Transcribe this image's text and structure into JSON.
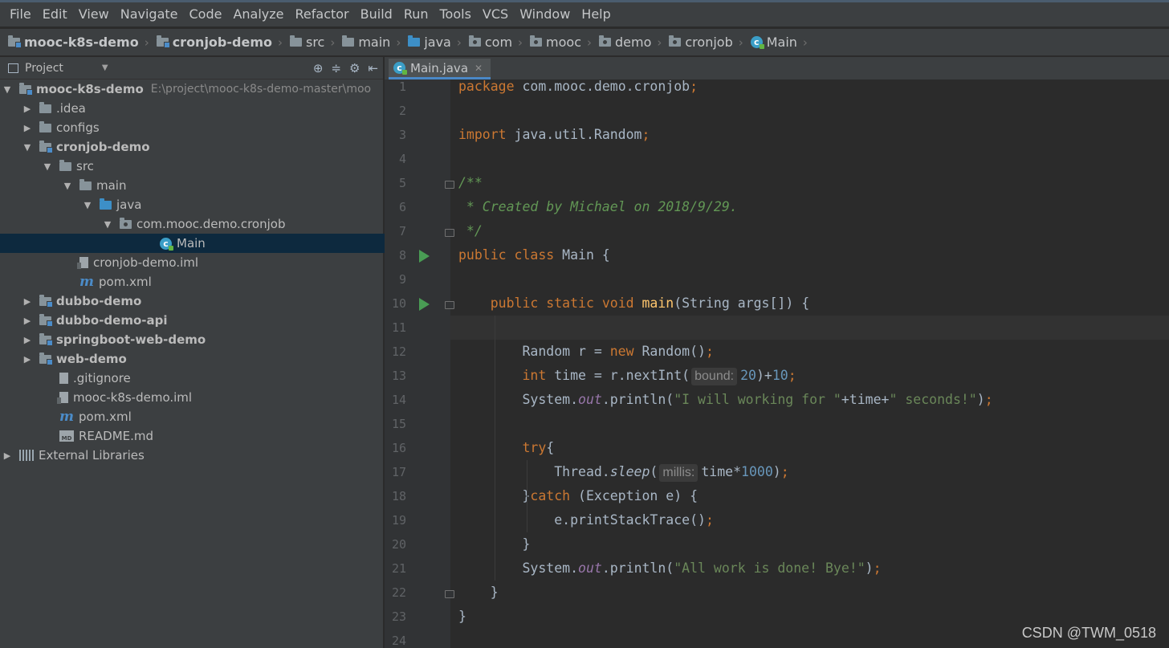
{
  "menu": [
    "File",
    "Edit",
    "View",
    "Navigate",
    "Code",
    "Analyze",
    "Refactor",
    "Build",
    "Run",
    "Tools",
    "VCS",
    "Window",
    "Help"
  ],
  "breadcrumb": [
    {
      "label": "mooc-k8s-demo",
      "icon": "module-folder-icon"
    },
    {
      "label": "cronjob-demo",
      "icon": "module-folder-icon"
    },
    {
      "label": "src",
      "icon": "folder-icon"
    },
    {
      "label": "main",
      "icon": "folder-icon"
    },
    {
      "label": "java",
      "icon": "source-folder-icon"
    },
    {
      "label": "com",
      "icon": "package-icon"
    },
    {
      "label": "mooc",
      "icon": "package-icon"
    },
    {
      "label": "demo",
      "icon": "package-icon"
    },
    {
      "label": "cronjob",
      "icon": "package-icon"
    },
    {
      "label": "Main",
      "icon": "class-icon"
    }
  ],
  "project": {
    "title": "Project",
    "tree": [
      {
        "label": "mooc-k8s-demo",
        "path": "E:\\project\\mooc-k8s-demo-master\\moo",
        "depth": 0,
        "arrow": "down",
        "icon": "module",
        "bold": true
      },
      {
        "label": ".idea",
        "depth": 1,
        "arrow": "right",
        "icon": "folder"
      },
      {
        "label": "configs",
        "depth": 1,
        "arrow": "right",
        "icon": "folder"
      },
      {
        "label": "cronjob-demo",
        "depth": 1,
        "arrow": "down",
        "icon": "module",
        "bold": true
      },
      {
        "label": "src",
        "depth": 2,
        "arrow": "down",
        "icon": "folder"
      },
      {
        "label": "main",
        "depth": 3,
        "arrow": "down",
        "icon": "folder"
      },
      {
        "label": "java",
        "depth": 4,
        "arrow": "down",
        "icon": "source"
      },
      {
        "label": "com.mooc.demo.cronjob",
        "depth": 5,
        "arrow": "down",
        "icon": "package"
      },
      {
        "label": "Main",
        "depth": 7,
        "arrow": "",
        "icon": "class",
        "selected": true
      },
      {
        "label": "cronjob-demo.iml",
        "depth": 3,
        "arrow": "",
        "icon": "iml"
      },
      {
        "label": "pom.xml",
        "depth": 3,
        "arrow": "",
        "icon": "maven"
      },
      {
        "label": "dubbo-demo",
        "depth": 1,
        "arrow": "right",
        "icon": "module",
        "bold": true
      },
      {
        "label": "dubbo-demo-api",
        "depth": 1,
        "arrow": "right",
        "icon": "module",
        "bold": true
      },
      {
        "label": "springboot-web-demo",
        "depth": 1,
        "arrow": "right",
        "icon": "module",
        "bold": true
      },
      {
        "label": "web-demo",
        "depth": 1,
        "arrow": "right",
        "icon": "module",
        "bold": true
      },
      {
        "label": ".gitignore",
        "depth": 2,
        "arrow": "",
        "icon": "file"
      },
      {
        "label": "mooc-k8s-demo.iml",
        "depth": 2,
        "arrow": "",
        "icon": "iml"
      },
      {
        "label": "pom.xml",
        "depth": 2,
        "arrow": "",
        "icon": "maven"
      },
      {
        "label": "README.md",
        "depth": 2,
        "arrow": "",
        "icon": "md"
      },
      {
        "label": "External Libraries",
        "depth": 0,
        "arrow": "right",
        "icon": "library"
      }
    ]
  },
  "editor": {
    "tab": "Main.java",
    "current_line": 11,
    "run_lines": [
      8,
      10
    ],
    "fold_lines": [
      5,
      7,
      10,
      22
    ],
    "lines": [
      [
        [
          "kw",
          "package "
        ],
        [
          "",
          "com.mooc.demo.cronjob"
        ],
        [
          "kw",
          ";"
        ]
      ],
      [],
      [
        [
          "kw",
          "import "
        ],
        [
          "",
          "java.util.Random"
        ],
        [
          "kw",
          ";"
        ]
      ],
      [],
      [
        [
          "cmt",
          "/**"
        ]
      ],
      [
        [
          "cmt",
          " * Created by Michael on 2018/9/29."
        ]
      ],
      [
        [
          "cmt",
          " */"
        ]
      ],
      [
        [
          "kw",
          "public class "
        ],
        [
          "",
          "Main {"
        ]
      ],
      [],
      [
        [
          "",
          "    "
        ],
        [
          "kw",
          "public static void "
        ],
        [
          "fn",
          "main"
        ],
        [
          "",
          "(String args[]) {"
        ]
      ],
      [],
      [
        [
          "",
          "        Random r = "
        ],
        [
          "kw",
          "new "
        ],
        [
          "",
          "Random()"
        ],
        [
          "kw",
          ";"
        ]
      ],
      [
        [
          "",
          "        "
        ],
        [
          "kw",
          "int "
        ],
        [
          "",
          "time = r.nextInt("
        ],
        [
          "hint",
          "bound:"
        ],
        [
          "num",
          "20"
        ],
        [
          "",
          ")+"
        ],
        [
          "num",
          "10"
        ],
        [
          "kw",
          ";"
        ]
      ],
      [
        [
          "",
          "        System."
        ],
        [
          "sfield",
          "out"
        ],
        [
          "",
          ".println("
        ],
        [
          "str",
          "\"I will working for \""
        ],
        [
          "",
          "+time+"
        ],
        [
          "str",
          "\" seconds!\""
        ],
        [
          "",
          ")"
        ],
        [
          "kw",
          ";"
        ]
      ],
      [],
      [
        [
          "",
          "        "
        ],
        [
          "kw",
          "try"
        ],
        [
          "",
          "{"
        ]
      ],
      [
        [
          "",
          "            Thread."
        ],
        [
          "smethod",
          "sleep"
        ],
        [
          "",
          "("
        ],
        [
          "hint",
          "millis:"
        ],
        [
          "",
          "time*"
        ],
        [
          "num",
          "1000"
        ],
        [
          "",
          ")"
        ],
        [
          "kw",
          ";"
        ]
      ],
      [
        [
          "",
          "        }"
        ],
        [
          "kw",
          "catch "
        ],
        [
          "",
          "(Exception e) {"
        ]
      ],
      [
        [
          "",
          "            e.printStackTrace()"
        ],
        [
          "kw",
          ";"
        ]
      ],
      [
        [
          "",
          "        }"
        ]
      ],
      [
        [
          "",
          "        System."
        ],
        [
          "sfield",
          "out"
        ],
        [
          "",
          ".println("
        ],
        [
          "str",
          "\"All work is done! Bye!\""
        ],
        [
          "",
          ")"
        ],
        [
          "kw",
          ";"
        ]
      ],
      [
        [
          "",
          "    }"
        ]
      ],
      [
        [
          "",
          "}"
        ]
      ],
      []
    ]
  },
  "watermark": "CSDN @TWM_0518"
}
